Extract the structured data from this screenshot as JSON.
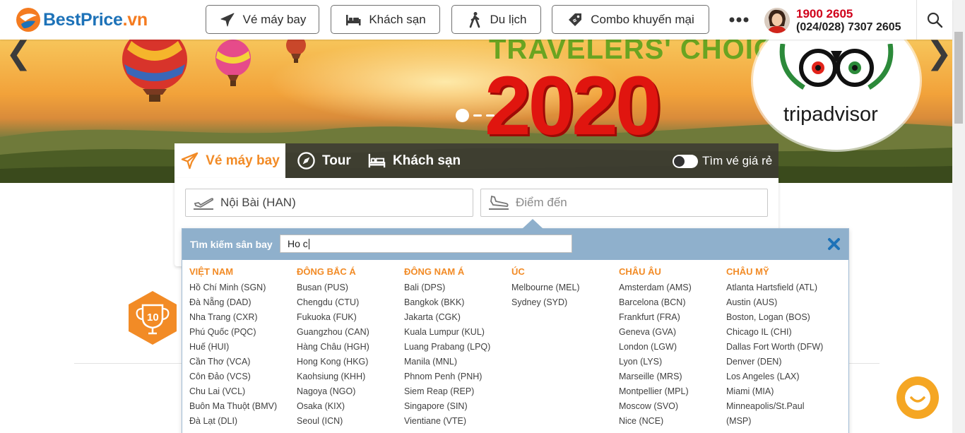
{
  "header": {
    "logo_text": "BestPrice",
    "logo_suffix": ".vn",
    "nav": [
      {
        "label": "Vé máy bay",
        "icon": "plane-icon"
      },
      {
        "label": "Khách sạn",
        "icon": "bed-icon"
      },
      {
        "label": "Du lịch",
        "icon": "hiker-icon"
      },
      {
        "label": "Combo khuyến mại",
        "icon": "tag-icon"
      }
    ],
    "more_icon": "more-dots-icon",
    "hotline_primary": "1900 2605",
    "hotline_secondary": "(024/028) 7307 2605"
  },
  "hero": {
    "headline": "TRAVELERS' CHOICE",
    "year": "2020",
    "brand": "tripadvisor",
    "arrow_left": "❮",
    "arrow_right": "❯"
  },
  "widget": {
    "tabs": [
      {
        "label": "Vé máy bay",
        "icon": "plane-icon",
        "active": true
      },
      {
        "label": "Tour",
        "icon": "compass-icon",
        "active": false
      },
      {
        "label": "Khách sạn",
        "icon": "bed-icon",
        "active": false
      }
    ],
    "cheap_toggle_label": "Tìm vé giá rẻ",
    "origin_value": "Nội Bài (HAN)",
    "destination_placeholder": "Điểm đến"
  },
  "airport_dropdown": {
    "search_label": "Tìm kiếm sân bay",
    "search_value": "Ho c",
    "regions": [
      {
        "name": "VIỆT NAM",
        "airports": [
          "Hồ Chí Minh (SGN)",
          "Đà Nẵng (DAD)",
          "Nha Trang (CXR)",
          "Phú Quốc (PQC)",
          "Huế (HUI)",
          "Cần Thơ (VCA)",
          "Côn Đảo (VCS)",
          "Chu Lai (VCL)",
          "Buôn Ma Thuột (BMV)",
          "Đà Lạt (DLI)"
        ]
      },
      {
        "name": "ĐÔNG BẮC Á",
        "airports": [
          "Busan (PUS)",
          "Chengdu (CTU)",
          "Fukuoka (FUK)",
          "Guangzhou (CAN)",
          "Hàng Châu (HGH)",
          "Hong Kong (HKG)",
          "Kaohsiung (KHH)",
          "Nagoya (NGO)",
          "Osaka (KIX)",
          "Seoul (ICN)"
        ]
      },
      {
        "name": "ĐÔNG NAM Á",
        "airports": [
          "Bali (DPS)",
          "Bangkok (BKK)",
          "Jakarta (CGK)",
          "Kuala Lumpur (KUL)",
          "Luang Prabang (LPQ)",
          "Manila (MNL)",
          "Phnom Penh (PNH)",
          "Siem Reap (REP)",
          "Singapore (SIN)",
          "Vientiane (VTE)"
        ]
      },
      {
        "name": "ÚC",
        "airports": [
          "Melbourne (MEL)",
          "Sydney (SYD)"
        ]
      },
      {
        "name": "CHÂU ÂU",
        "airports": [
          "Amsterdam (AMS)",
          "Barcelona (BCN)",
          "Frankfurt (FRA)",
          "Geneva (GVA)",
          "London (LGW)",
          "Lyon (LYS)",
          "Marseille (MRS)",
          "Montpellier (MPL)",
          "Moscow (SVO)",
          "Nice (NCE)"
        ]
      },
      {
        "name": "CHÂU MỸ",
        "airports": [
          "Atlanta Hartsfield (ATL)",
          "Austin (AUS)",
          "Boston, Logan (BOS)",
          "Chicago IL (CHI)",
          "Dallas Fort Worth (DFW)",
          "Denver (DEN)",
          "Los Angeles (LAX)",
          "Miami (MIA)",
          "Minneapolis/St.Paul",
          "(MSP)"
        ]
      }
    ]
  },
  "colors": {
    "brand_blue": "#1d72b8",
    "brand_orange": "#f28b26",
    "hotline_red": "#d0021b",
    "dropdown_header": "#8fb0cc",
    "chat_orange": "#f5a623"
  }
}
